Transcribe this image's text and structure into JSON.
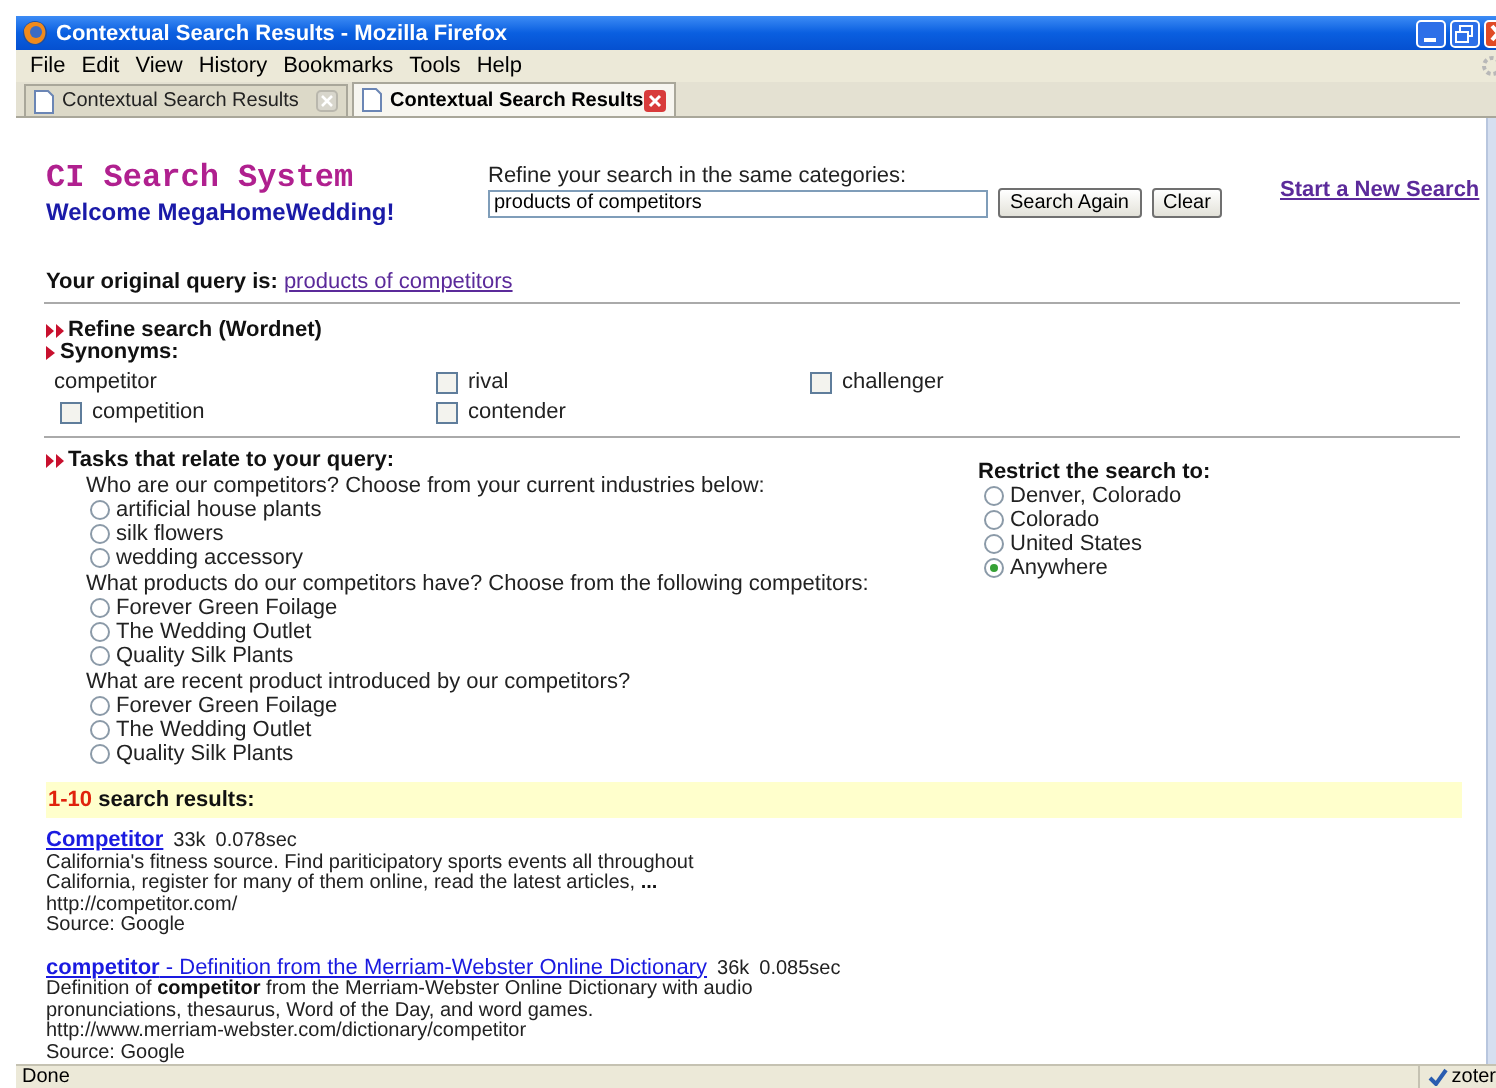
{
  "window": {
    "title": "Contextual Search Results - Mozilla Firefox"
  },
  "menu": [
    "File",
    "Edit",
    "View",
    "History",
    "Bookmarks",
    "Tools",
    "Help"
  ],
  "tabs": [
    {
      "label": "Contextual Search Results",
      "selected": false
    },
    {
      "label": "Contextual Search Results",
      "selected": true
    }
  ],
  "header": {
    "title": "CI Search System",
    "welcome": "Welcome MegaHomeWedding!",
    "refine_label": "Refine your search in the same categories:",
    "refine_value": "products of competitors",
    "buttons": [
      "Search Again",
      "Clear"
    ],
    "new_search": "Start a New Search"
  },
  "original_query": {
    "label": "Your original query is:",
    "query": "products of competitors"
  },
  "wordnet": {
    "heading": "Refine search (Wordnet)",
    "synonyms_heading": "Synonyms:",
    "synonyms": [
      {
        "label": "competitor",
        "kind": "plain"
      },
      {
        "label": "rival",
        "kind": "checkbox",
        "checked": false
      },
      {
        "label": "challenger",
        "kind": "checkbox",
        "checked": false
      },
      {
        "label": "competition",
        "kind": "checkbox",
        "checked": false
      },
      {
        "label": "contender",
        "kind": "checkbox",
        "checked": false
      }
    ]
  },
  "tasks": {
    "heading": "Tasks that relate to your query:",
    "groups": [
      {
        "question": "Who are our competitors? Choose from your current industries below:",
        "options": [
          {
            "label": "artificial house plants",
            "selected": false
          },
          {
            "label": "silk flowers",
            "selected": false
          },
          {
            "label": "wedding accessory",
            "selected": false
          }
        ]
      },
      {
        "question": "What products do our competitors have? Choose from the following competitors:",
        "options": [
          {
            "label": "Forever Green Foilage",
            "selected": false
          },
          {
            "label": "The Wedding Outlet",
            "selected": false
          },
          {
            "label": "Quality Silk Plants",
            "selected": false
          }
        ]
      },
      {
        "question": "What are recent product introduced by our competitors?",
        "options": [
          {
            "label": "Forever Green Foilage",
            "selected": false
          },
          {
            "label": "The Wedding Outlet",
            "selected": false
          },
          {
            "label": "Quality Silk Plants",
            "selected": false
          }
        ]
      }
    ]
  },
  "restrict": {
    "heading": "Restrict the search to:",
    "options": [
      {
        "label": "Denver, Colorado",
        "selected": false
      },
      {
        "label": "Colorado",
        "selected": false
      },
      {
        "label": "United States",
        "selected": false
      },
      {
        "label": "Anywhere",
        "selected": true
      }
    ]
  },
  "results_header": {
    "range": "1-10",
    "label": "search results:"
  },
  "results": [
    {
      "title": "Competitor",
      "bold": true,
      "size": "33k",
      "time": "0.078sec",
      "snippet_lines": [
        "California's fitness source. Find pariticipatory sports events all throughout",
        "California, register for many of them online, read the latest articles, **...**"
      ],
      "url": "http://competitor.com/",
      "source": "Source: Google"
    },
    {
      "title": "**competitor** - Definition from the Merriam-Webster Online Dictionary",
      "bold": false,
      "size": "36k",
      "time": "0.085sec",
      "snippet_lines": [
        "Definition of **competitor** from the Merriam-Webster Online Dictionary with audio",
        "pronunciations, thesaurus, Word of the Day, and word games."
      ],
      "url": "http://www.merriam-webster.com/dictionary/competitor",
      "source": "Source: Google"
    }
  ],
  "status_bar": {
    "text": "Done",
    "addon": "zoter"
  }
}
